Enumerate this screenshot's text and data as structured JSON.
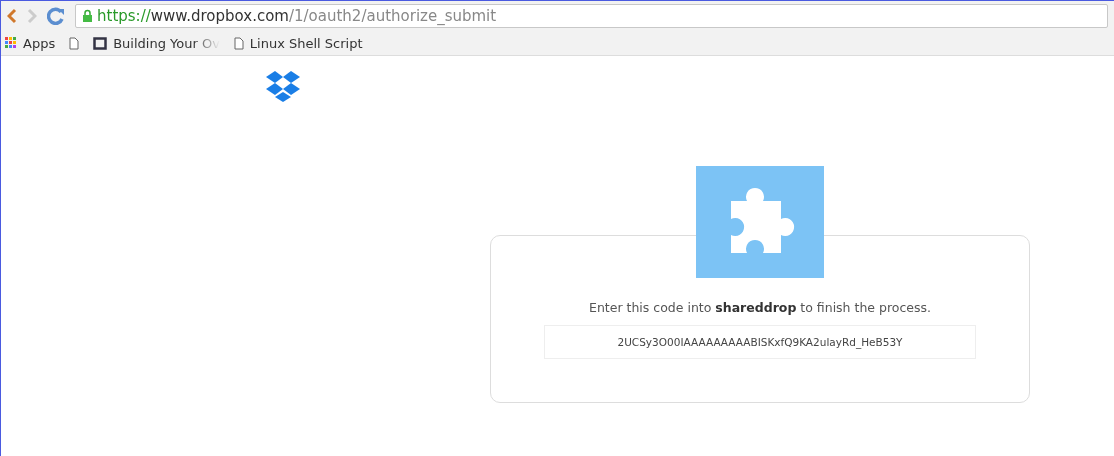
{
  "address_bar": {
    "scheme": "https://",
    "host": "www.dropbox.com",
    "path": "/1/oauth2/authorize_submit",
    "secure": true
  },
  "bookmarks": [
    {
      "kind": "apps",
      "label": "Apps"
    },
    {
      "kind": "page"
    },
    {
      "kind": "window",
      "label": "Building Your Ov"
    },
    {
      "kind": "page",
      "label": "Linux Shell Script"
    }
  ],
  "card": {
    "message": "Enter this code into **shareddrop** to finish the process.",
    "code": "2UCSy3O00IAAAAAAAAABISKxfQ9KA2ulayRd_HeB53Y"
  }
}
